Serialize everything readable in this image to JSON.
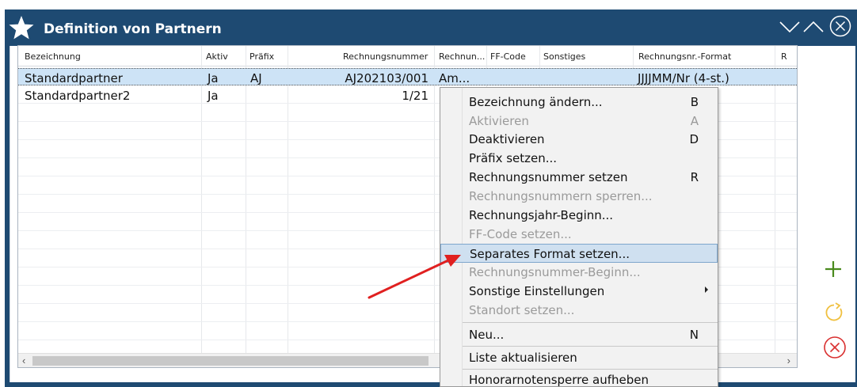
{
  "window": {
    "title": "Definition von Partnern"
  },
  "table": {
    "headers": [
      "Bezeichnung",
      "Aktiv",
      "Präfix",
      "Rechnungsnummer",
      "Rechnun...",
      "FF-Code",
      "Sonstiges",
      "Rechnungsnr.-Format",
      "R"
    ],
    "rows": [
      {
        "bezeichnung": "Standardpartner",
        "aktiv": "Ja",
        "praefix": "AJ",
        "rechnungsnummer": "AJ202103/001",
        "rechnungsjahr": "Am...",
        "format": "JJJJMM/Nr (4-st.)"
      },
      {
        "bezeichnung": "Standardpartner2",
        "aktiv": "Ja",
        "praefix": "",
        "rechnungsnummer": "1/21",
        "rechnungsjahr": "",
        "format": ""
      }
    ]
  },
  "context_menu": {
    "items": [
      {
        "label": "Bezeichnung ändern...",
        "key": "B",
        "enabled": true
      },
      {
        "label": "Aktivieren",
        "key": "A",
        "enabled": false
      },
      {
        "label": "Deaktivieren",
        "key": "D",
        "enabled": true
      },
      {
        "label": "Präfix setzen...",
        "key": "",
        "enabled": true
      },
      {
        "label": "Rechnungsnummer setzen",
        "key": "R",
        "enabled": true
      },
      {
        "label": "Rechnungsnummern sperren...",
        "key": "",
        "enabled": false
      },
      {
        "label": "Rechnungsjahr-Beginn...",
        "key": "",
        "enabled": true
      },
      {
        "label": "FF-Code setzen...",
        "key": "",
        "enabled": false
      },
      {
        "label": "Separates Format setzen...",
        "key": "",
        "enabled": true,
        "highlighted": true
      },
      {
        "label": "Rechnungsnummer-Beginn...",
        "key": "",
        "enabled": false
      },
      {
        "label": "Sonstige Einstellungen",
        "key": "",
        "enabled": true,
        "submenu": true
      },
      {
        "label": "Standort setzen...",
        "key": "",
        "enabled": false
      },
      {
        "label": "Neu...",
        "key": "N",
        "enabled": true
      },
      {
        "label": "Liste aktualisieren",
        "key": "",
        "enabled": true
      },
      {
        "label": "Honorarnotensperre aufheben",
        "key": "",
        "enabled": true
      }
    ]
  },
  "icons": {
    "title": "star-icon",
    "add": "plus-icon",
    "refresh": "refresh-icon",
    "delete": "close-circle-icon"
  },
  "colors": {
    "titlebar": "#1e4a72",
    "selection": "#cde3f6",
    "add_green": "#4a8a1e",
    "refresh_yellow": "#f0c040",
    "delete_red": "#d93030",
    "annotation_red": "#e02020"
  }
}
